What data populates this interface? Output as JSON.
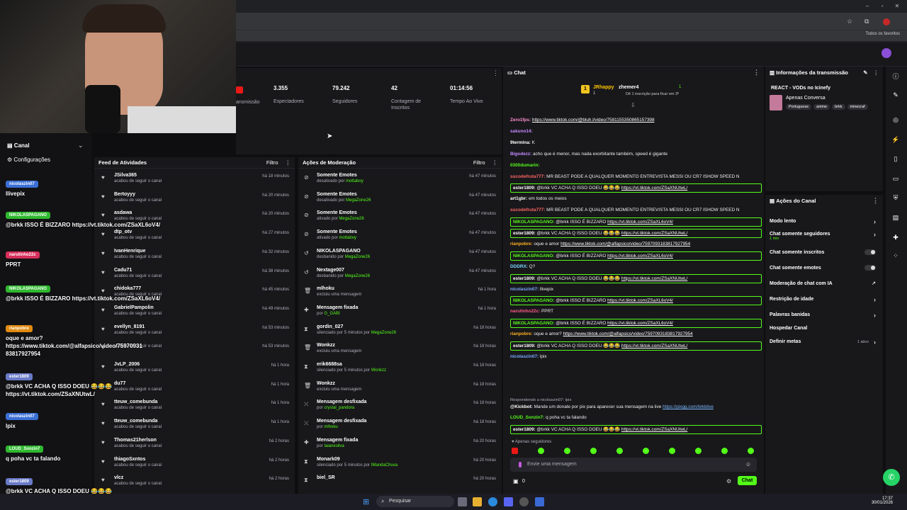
{
  "browser": {
    "bookmarks_label": "Todos os favoritos"
  },
  "stats": [
    {
      "value": "",
      "label": "ansmissão"
    },
    {
      "value": "3.355",
      "label": "Espectadores"
    },
    {
      "value": "79.242",
      "label": "Seguidores"
    },
    {
      "value": "42",
      "label": "Contagem de Inscritos"
    },
    {
      "value": "01:14:56",
      "label": "Tempo Ao Vivo"
    }
  ],
  "left_menu": {
    "channel": "Canal",
    "settings": "Configurações"
  },
  "activity": {
    "title": "Feed de Atividades",
    "filter": "Filtro",
    "items": [
      {
        "name": "JSilva365",
        "sub": "acabou de seguir o canal",
        "time": "há 18 minutos"
      },
      {
        "name": "Bertoyyy",
        "sub": "acabou de seguir o canal",
        "time": "há 20 minutos"
      },
      {
        "name": "asdawa",
        "sub": "acabou de seguir o canal",
        "time": "há 20 minutos"
      },
      {
        "name": "dtp_otv",
        "sub": "acabou de seguir o canal",
        "time": "há 27 minutos"
      },
      {
        "name": "IvanHenrique",
        "sub": "acabou de seguir o canal",
        "time": "há 32 minutos"
      },
      {
        "name": "Cadu71",
        "sub": "acabou de seguir o canal",
        "time": "há 38 minutos"
      },
      {
        "name": "chidoka777",
        "sub": "acabou de seguir o canal",
        "time": "há 45 minutos"
      },
      {
        "name": "GabrielPampolin",
        "sub": "acabou de seguir o canal",
        "time": "há 49 minutos"
      },
      {
        "name": "evellyn_8191",
        "sub": "acabou de seguir o canal",
        "time": "há 53 minutos"
      },
      {
        "name": "",
        "sub": "acabou de seguir o canal",
        "time": "há 53 minutos"
      },
      {
        "name": "JvLP_2006",
        "sub": "acabou de seguir o canal",
        "time": "há 1 hora"
      },
      {
        "name": "du77",
        "sub": "acabou de seguir o canal",
        "time": "há 1 hora"
      },
      {
        "name": "tteuw_comebunda",
        "sub": "acabou de seguir o canal",
        "time": "há 1 hora"
      },
      {
        "name": "tteuw_comebunda",
        "sub": "acabou de seguir o canal",
        "time": "há 1 hora"
      },
      {
        "name": "Thomas21herlson",
        "sub": "acabou de seguir o canal",
        "time": "há 2 horas"
      },
      {
        "name": "thiagoSxntos",
        "sub": "acabou de seguir o canal",
        "time": "há 2 horas"
      },
      {
        "name": "vlcz",
        "sub": "acabou de seguir o canal",
        "time": "há 2 horas"
      }
    ]
  },
  "moderation": {
    "title": "Ações de Moderação",
    "filter": "Filtro",
    "items": [
      {
        "icon": "ban",
        "name": "Somente Emotes",
        "pre": "desativado por",
        "by": "mottaboy",
        "time": "há 47 minutos"
      },
      {
        "icon": "ban",
        "name": "Somente Emotes",
        "pre": "desativado por",
        "by": "MegaZone26",
        "time": "há 47 minutos"
      },
      {
        "icon": "ban",
        "name": "Somente Emotes",
        "pre": "ativado por",
        "by": "MegaZone26",
        "time": "há 47 minutos"
      },
      {
        "icon": "ban",
        "name": "Somente Emotes",
        "pre": "ativado por",
        "by": "mottaboy",
        "time": "há 47 minutos"
      },
      {
        "icon": "undo",
        "name": "NIKOLASPAGANO",
        "pre": "desbanido por",
        "by": "MegaZone26",
        "time": "há 47 minutos"
      },
      {
        "icon": "undo",
        "name": "Nextage007",
        "pre": "desbanido por",
        "by": "MegaZone26",
        "time": "há 47 minutos"
      },
      {
        "icon": "trash",
        "name": "mlhoku",
        "pre": "excluiu uma mensagem",
        "by": "",
        "time": "há 1 hora"
      },
      {
        "icon": "pin",
        "name": "Mensagem fixada",
        "pre": "por",
        "by": "G_GABI",
        "time": "há 1 hora"
      },
      {
        "icon": "timer",
        "name": "gordin_027",
        "pre": "silenciado por 5 minutos por",
        "by": "MegaZone26",
        "time": "há 18 horas"
      },
      {
        "icon": "trash",
        "name": "Wonkzz",
        "pre": "excluiu uma mensagem",
        "by": "",
        "time": "há 18 horas"
      },
      {
        "icon": "timer",
        "name": "erik6688sa",
        "pre": "silenciado por 5 minutos por",
        "by": "Wonkzz",
        "time": "há 18 horas"
      },
      {
        "icon": "trash",
        "name": "Wonkzz",
        "pre": "excluiu uma mensagem",
        "by": "",
        "time": "há 18 horas"
      },
      {
        "icon": "unpin",
        "name": "Mensagem desfixada",
        "pre": "por",
        "by": "crystal_pandora",
        "time": "há 18 horas"
      },
      {
        "icon": "unpin",
        "name": "Mensagem desfixada",
        "pre": "por",
        "by": "mlhoku",
        "time": "há 18 horas"
      },
      {
        "icon": "pin",
        "name": "Mensagem fixada",
        "pre": "por",
        "by": "Iaianesilva",
        "time": "há 20 horas"
      },
      {
        "icon": "timer",
        "name": "Monark09",
        "pre": "silenciado por 5 minutos por",
        "by": "IMandaChuva",
        "time": "há 20 horas"
      },
      {
        "icon": "timer",
        "name": "biel_SR",
        "pre": "",
        "by": "",
        "time": "há 20 horas"
      }
    ]
  },
  "chat": {
    "title": "Chat",
    "top": {
      "user1": "JRhappy",
      "user1_count": "1",
      "user2": "zhemer4",
      "user2_count": "1",
      "note": "Dê 1 inscrição para ficar em 3º"
    },
    "lines": [
      {
        "user": "Zero1fps:",
        "color": "#ff8fd0",
        "text": "",
        "link": "https://www.tiktok.com/@bluh.l/video/7581155350865157398",
        "hl": false
      },
      {
        "user": "sakuno14:",
        "color": "#c78aff",
        "text": "",
        "link": "",
        "hl": false
      },
      {
        "user": "9termina:",
        "color": "#ffffff",
        "text": "K",
        "link": "",
        "hl": false
      },
      {
        "user": "Bigodezz:",
        "color": "#c78aff",
        "text": "acho que é menor, mas nada exorbitante também, speed é gigante",
        "link": "",
        "hl": false
      },
      {
        "user": "0300dumarin:",
        "color": "#53fc18",
        "text": "",
        "link": "",
        "hl": false
      },
      {
        "user": "sucodefruta777:",
        "color": "#ff6464",
        "text": "MR BEAST PODE A QUALQUER MOMENTO ENTREVISTA MESSI OU CR7 ISHOW SPEED N",
        "link": "",
        "hl": false
      },
      {
        "user": "ester1809:",
        "color": "#ffffff",
        "text": "@brkk VC ACHA Q ISSO DOEU 😂😂😂",
        "link": "https://vt.tiktok.com/ZSaXNUtwL/",
        "hl": true
      },
      {
        "user": "art1gbr:",
        "color": "#ffffff",
        "text": "em todos os meios",
        "link": "",
        "hl": false
      },
      {
        "user": "sucodefruta777:",
        "color": "#ff6464",
        "text": "MR BEAST PODE A QUALQUER MOMENTO ENTREVISTA MESSI OU CR7 ISHOW SPEED N",
        "link": "",
        "hl": false
      },
      {
        "user": "NIKOLASPAGANO:",
        "color": "#53fc18",
        "text": "@brkk ISSO É BIZZARO",
        "link": "https://vt.tiktok.com/ZSaXL6oV4/",
        "hl": true
      },
      {
        "user": "ester1809:",
        "color": "#ffffff",
        "text": "@brkk VC ACHA Q ISSO DOEU 😂😂😂",
        "link": "https://vt.tiktok.com/ZSaXNUtwL/",
        "hl": true
      },
      {
        "user": "rianpobre:",
        "color": "#ffb020",
        "text": "oque e amor",
        "link": "https://www.tiktok.com/@alfapsico/video/7597093183817927954",
        "hl": false
      },
      {
        "user": "NIKOLASPAGANO:",
        "color": "#53fc18",
        "text": "@brkk ISSO É BIZZARO",
        "link": "https://vt.tiktok.com/ZSaXL6oV4/",
        "hl": true
      },
      {
        "user": "DDDRX:",
        "color": "#7ad7ff",
        "text": "Q?",
        "link": "",
        "hl": false
      },
      {
        "user": "ester1809:",
        "color": "#ffffff",
        "text": "@brkk VC ACHA Q ISSO DOEU 😂😂😂",
        "link": "https://vt.tiktok.com/ZSaXNUtwL/",
        "hl": true
      },
      {
        "user": "nicolaszin07:",
        "color": "#7aa7ff",
        "text": "llivepix",
        "link": "",
        "hl": false
      },
      {
        "user": "NIKOLASPAGANO:",
        "color": "#53fc18",
        "text": "@brkk ISSO É BIZZARO",
        "link": "https://vt.tiktok.com/ZSaXL6oV4/",
        "hl": true
      },
      {
        "user": "narutinho22c:",
        "color": "#ff5a8a",
        "text": "PPRT",
        "link": "",
        "hl": false
      },
      {
        "user": "NIKOLASPAGANO:",
        "color": "#53fc18",
        "text": "@brkk ISSO É BIZZARO",
        "link": "https://vt.tiktok.com/ZSaXL6oV4/",
        "hl": true
      },
      {
        "user": "rianpobre:",
        "color": "#ffb020",
        "text": "oque e amor?",
        "link": "https://www.tiktok.com/@alfapsico/video/7597093183817927954",
        "hl": false
      },
      {
        "user": "ester1809:",
        "color": "#ffffff",
        "text": "@brkk VC ACHA Q ISSO DOEU 😂😂😂",
        "link": "https://vt.tiktok.com/ZSaXNUtwL/",
        "hl": true
      },
      {
        "user": "nicolaszin07:",
        "color": "#7aa7ff",
        "text": "lpix",
        "link": "",
        "hl": false
      }
    ],
    "reply_note": "Respondendo a nicolaszin07: lpix",
    "kickbot": {
      "user": "@Kickbot:",
      "text": "Mande um donate por pix para aparecer sua mensagem na live",
      "link": "https://pixgg.com/brkklive"
    },
    "after": [
      {
        "user": "LOUD_Sonzin7:",
        "color": "#53fc18",
        "text": "q poha vc ta falando",
        "link": "",
        "hl": false
      },
      {
        "user": "ester1809:",
        "color": "#ffffff",
        "text": "@brkk VC ACHA Q ISSO DOEU 😂😂😂",
        "link": "https://vt.tiktok.com/ZSaXNUtwL/",
        "hl": true
      }
    ],
    "followers_only": "Apenas seguidores",
    "input_placeholder": "Envie uma mensagem",
    "count": "0",
    "send_label": "Chat"
  },
  "stream_info": {
    "title": "Informações da transmissão",
    "stream_title": "REACT - VODs no Icinefy",
    "category": "Apenas Conversa",
    "tags": [
      "Portuguese",
      "anime",
      "brkk",
      "minecraf"
    ]
  },
  "channel_actions": {
    "title": "Ações do Canal",
    "items": [
      {
        "label": "Modo lento",
        "control": "chevron",
        "extra": ""
      },
      {
        "label": "Chat somente seguidores",
        "control": "chevron",
        "extra": "1 min"
      },
      {
        "label": "Chat somente inscritos",
        "control": "toggle",
        "extra": ""
      },
      {
        "label": "Chat somente emotes",
        "control": "toggle",
        "extra": ""
      },
      {
        "label": "Moderação de chat com IA",
        "control": "external",
        "extra": ""
      },
      {
        "label": "Restrição de idade",
        "control": "chevron",
        "extra": ""
      },
      {
        "label": "Palavras banidas",
        "control": "chevron",
        "extra": ""
      },
      {
        "label": "Hospedar Canal",
        "control": "none",
        "extra": ""
      },
      {
        "label": "Definir metas",
        "control": "chevron",
        "extra": "1 ativo"
      }
    ]
  },
  "overlay_chat": [
    {
      "name": "nicolaszin07",
      "color": "#3b6fd6",
      "msg": "llivepix"
    },
    {
      "name": "NIKOLASPAGANO",
      "color": "#2fb82f",
      "msg": "@brkk ISSO É BIZZARO https://vt.tiktok.com/ZSaXL6oV4/"
    },
    {
      "name": "narutinho22c",
      "color": "#d62e5a",
      "msg": "PPRT"
    },
    {
      "name": "NIKOLASPAGANO",
      "color": "#2fb82f",
      "msg": "@brkk ISSO É BIZZARO https://vt.tiktok.com/ZSaXL6oV4/"
    },
    {
      "name": "rianpobre",
      "color": "#e08a10",
      "msg": "oque e amor? https://www.tiktok.com/@alfapsico/video/75970931 83817927954"
    },
    {
      "name": "ester1809",
      "color": "#6a7bc8",
      "msg": "@brkk VC ACHA Q ISSO DOEU 😂😂😂 https://vt.tiktok.com/ZSaXNUtwL/"
    },
    {
      "name": "nicolaszin07",
      "color": "#3b6fd6",
      "msg": "lpix"
    },
    {
      "name": "LOUD_Sonzin7",
      "color": "#2fb82f",
      "msg": "q poha vc ta falando"
    },
    {
      "name": "ester1809",
      "color": "#6a7bc8",
      "msg": "@brkk VC ACHA Q ISSO DOEU 😂😂😂 https://vt.tiktok.com/ZSaXNUtwL/"
    }
  ],
  "taskbar": {
    "search_label": "Pesquisar",
    "time": "17:37",
    "date": "30/01/2026"
  },
  "colors": {
    "accent": "#53fc18",
    "bg": "#0e0e10",
    "panel": "#18181b"
  }
}
